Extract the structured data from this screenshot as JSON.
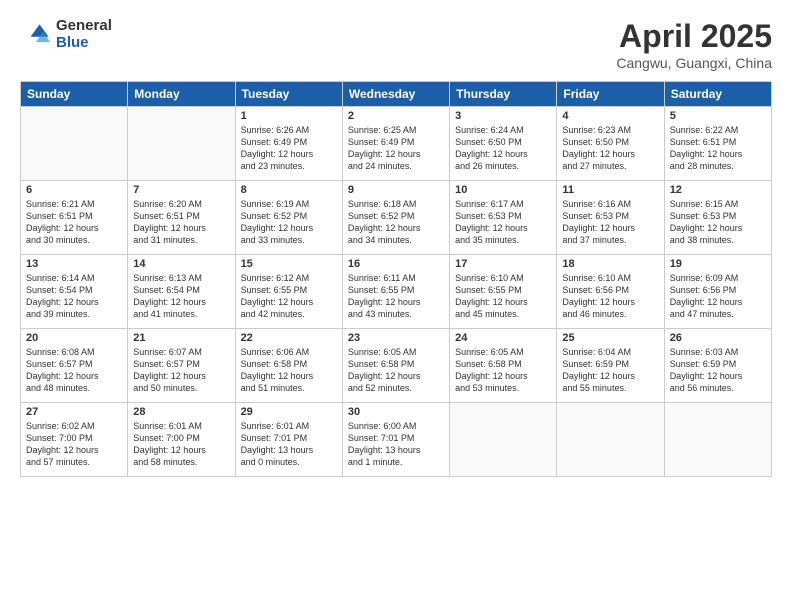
{
  "logo": {
    "general": "General",
    "blue": "Blue"
  },
  "header": {
    "title": "April 2025",
    "subtitle": "Cangwu, Guangxi, China"
  },
  "weekdays": [
    "Sunday",
    "Monday",
    "Tuesday",
    "Wednesday",
    "Thursday",
    "Friday",
    "Saturday"
  ],
  "weeks": [
    [
      {
        "day": "",
        "detail": ""
      },
      {
        "day": "",
        "detail": ""
      },
      {
        "day": "1",
        "detail": "Sunrise: 6:26 AM\nSunset: 6:49 PM\nDaylight: 12 hours\nand 23 minutes."
      },
      {
        "day": "2",
        "detail": "Sunrise: 6:25 AM\nSunset: 6:49 PM\nDaylight: 12 hours\nand 24 minutes."
      },
      {
        "day": "3",
        "detail": "Sunrise: 6:24 AM\nSunset: 6:50 PM\nDaylight: 12 hours\nand 26 minutes."
      },
      {
        "day": "4",
        "detail": "Sunrise: 6:23 AM\nSunset: 6:50 PM\nDaylight: 12 hours\nand 27 minutes."
      },
      {
        "day": "5",
        "detail": "Sunrise: 6:22 AM\nSunset: 6:51 PM\nDaylight: 12 hours\nand 28 minutes."
      }
    ],
    [
      {
        "day": "6",
        "detail": "Sunrise: 6:21 AM\nSunset: 6:51 PM\nDaylight: 12 hours\nand 30 minutes."
      },
      {
        "day": "7",
        "detail": "Sunrise: 6:20 AM\nSunset: 6:51 PM\nDaylight: 12 hours\nand 31 minutes."
      },
      {
        "day": "8",
        "detail": "Sunrise: 6:19 AM\nSunset: 6:52 PM\nDaylight: 12 hours\nand 33 minutes."
      },
      {
        "day": "9",
        "detail": "Sunrise: 6:18 AM\nSunset: 6:52 PM\nDaylight: 12 hours\nand 34 minutes."
      },
      {
        "day": "10",
        "detail": "Sunrise: 6:17 AM\nSunset: 6:53 PM\nDaylight: 12 hours\nand 35 minutes."
      },
      {
        "day": "11",
        "detail": "Sunrise: 6:16 AM\nSunset: 6:53 PM\nDaylight: 12 hours\nand 37 minutes."
      },
      {
        "day": "12",
        "detail": "Sunrise: 6:15 AM\nSunset: 6:53 PM\nDaylight: 12 hours\nand 38 minutes."
      }
    ],
    [
      {
        "day": "13",
        "detail": "Sunrise: 6:14 AM\nSunset: 6:54 PM\nDaylight: 12 hours\nand 39 minutes."
      },
      {
        "day": "14",
        "detail": "Sunrise: 6:13 AM\nSunset: 6:54 PM\nDaylight: 12 hours\nand 41 minutes."
      },
      {
        "day": "15",
        "detail": "Sunrise: 6:12 AM\nSunset: 6:55 PM\nDaylight: 12 hours\nand 42 minutes."
      },
      {
        "day": "16",
        "detail": "Sunrise: 6:11 AM\nSunset: 6:55 PM\nDaylight: 12 hours\nand 43 minutes."
      },
      {
        "day": "17",
        "detail": "Sunrise: 6:10 AM\nSunset: 6:55 PM\nDaylight: 12 hours\nand 45 minutes."
      },
      {
        "day": "18",
        "detail": "Sunrise: 6:10 AM\nSunset: 6:56 PM\nDaylight: 12 hours\nand 46 minutes."
      },
      {
        "day": "19",
        "detail": "Sunrise: 6:09 AM\nSunset: 6:56 PM\nDaylight: 12 hours\nand 47 minutes."
      }
    ],
    [
      {
        "day": "20",
        "detail": "Sunrise: 6:08 AM\nSunset: 6:57 PM\nDaylight: 12 hours\nand 48 minutes."
      },
      {
        "day": "21",
        "detail": "Sunrise: 6:07 AM\nSunset: 6:57 PM\nDaylight: 12 hours\nand 50 minutes."
      },
      {
        "day": "22",
        "detail": "Sunrise: 6:06 AM\nSunset: 6:58 PM\nDaylight: 12 hours\nand 51 minutes."
      },
      {
        "day": "23",
        "detail": "Sunrise: 6:05 AM\nSunset: 6:58 PM\nDaylight: 12 hours\nand 52 minutes."
      },
      {
        "day": "24",
        "detail": "Sunrise: 6:05 AM\nSunset: 6:58 PM\nDaylight: 12 hours\nand 53 minutes."
      },
      {
        "day": "25",
        "detail": "Sunrise: 6:04 AM\nSunset: 6:59 PM\nDaylight: 12 hours\nand 55 minutes."
      },
      {
        "day": "26",
        "detail": "Sunrise: 6:03 AM\nSunset: 6:59 PM\nDaylight: 12 hours\nand 56 minutes."
      }
    ],
    [
      {
        "day": "27",
        "detail": "Sunrise: 6:02 AM\nSunset: 7:00 PM\nDaylight: 12 hours\nand 57 minutes."
      },
      {
        "day": "28",
        "detail": "Sunrise: 6:01 AM\nSunset: 7:00 PM\nDaylight: 12 hours\nand 58 minutes."
      },
      {
        "day": "29",
        "detail": "Sunrise: 6:01 AM\nSunset: 7:01 PM\nDaylight: 13 hours\nand 0 minutes."
      },
      {
        "day": "30",
        "detail": "Sunrise: 6:00 AM\nSunset: 7:01 PM\nDaylight: 13 hours\nand 1 minute."
      },
      {
        "day": "",
        "detail": ""
      },
      {
        "day": "",
        "detail": ""
      },
      {
        "day": "",
        "detail": ""
      }
    ]
  ]
}
